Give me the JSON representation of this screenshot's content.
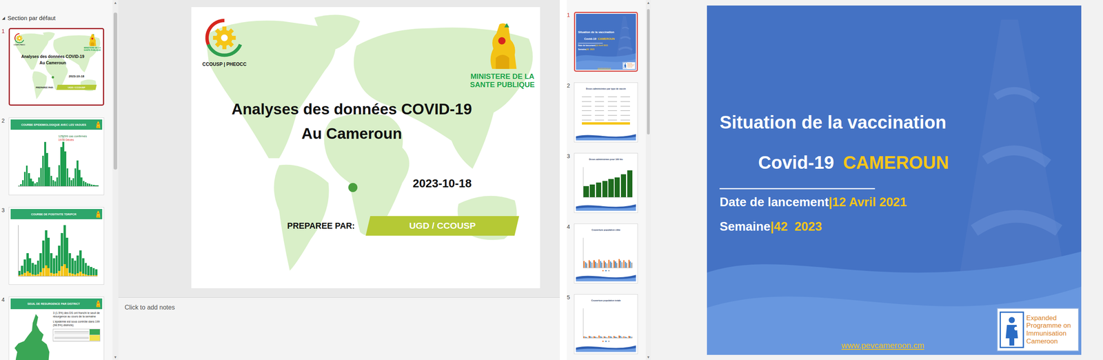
{
  "left_window": {
    "section": {
      "icon": "◢",
      "label": "Section par défaut",
      "expanded": true
    },
    "scrollbar": {
      "up": "▲",
      "down": "▼",
      "thumb_start": 0.02,
      "thumb_size": 0.45
    },
    "thumbnails": [
      {
        "number": "1",
        "kind": "title",
        "selected": true
      },
      {
        "number": "2",
        "kind": "curve",
        "selected": false,
        "title": "COURBE EPIDEMIOLOGIQUE AVEC LES VAGUES",
        "color": "#1e9e50",
        "labels": [
          {
            "text": "125299 cas confirmés",
            "color": "#1f7a3a"
          },
          {
            "text": "1974 Décès",
            "color": "#e0241b"
          }
        ],
        "values": [
          20,
          60,
          180,
          420,
          610,
          380,
          220,
          140,
          90,
          120,
          260,
          540,
          900,
          1300,
          980,
          560,
          300,
          180,
          140,
          260,
          620,
          1150,
          1480,
          1020,
          520,
          260,
          180,
          240,
          520,
          760,
          480,
          260,
          160,
          120,
          90,
          70,
          50,
          40,
          30,
          25
        ]
      },
      {
        "number": "3",
        "kind": "positivity",
        "selected": false,
        "title": "COURBE DE POSITIVITE TDR/PCR",
        "series": [
          {
            "color": "#1e9e50",
            "values": [
              200,
              400,
              650,
              900,
              700,
              500,
              450,
              600,
              900,
              1400,
              1800,
              1500,
              900,
              700,
              800,
              1200,
              1700,
              2000,
              1500,
              900,
              700,
              600,
              800,
              1000,
              700,
              500,
              400,
              350,
              300,
              250
            ]
          },
          {
            "color": "#f2c316",
            "values": [
              20,
              60,
              120,
              180,
              110,
              60,
              40,
              70,
              150,
              300,
              420,
              300,
              120,
              80,
              100,
              200,
              380,
              460,
              300,
              120,
              80,
              60,
              100,
              160,
              90,
              50,
              30,
              25,
              20,
              15
            ]
          }
        ]
      },
      {
        "number": "4",
        "kind": "map",
        "selected": false,
        "title": "SEUIL DE RESURGENCE PAR DISTRICT",
        "lines": [
          "3 (1.5%) des DS ont franchi le seuil de résurgence au cours de la semaine",
          "L'épidémie est sous contrôle dans 199 (98.5%) districts)"
        ],
        "status_colors": [
          "#3aa655",
          "#f2e14c"
        ]
      }
    ],
    "slide": {
      "logo_label": "CCOUSP | PHEOCC",
      "ministry": "MINISTERE DE LA SANTE PUBLIQUE",
      "title_lines": [
        "Analyses des données COVID-19",
        "Au Cameroun"
      ],
      "date": "2023-10-18",
      "prepared_label": "PREPAREE PAR:",
      "prepared_by": "UGD / CCOUSP"
    },
    "notes_placeholder": "Click to add notes"
  },
  "right_window": {
    "scrollbar": {
      "up": "▲",
      "down": "▼",
      "thumb_start": 0.01,
      "thumb_size": 0.36
    },
    "thumbnails": [
      {
        "number": "1",
        "kind": "title",
        "selected": true
      },
      {
        "number": "2",
        "kind": "table",
        "selected": false,
        "title": "Doses administrées par type de vaccin",
        "table_rows": 6
      },
      {
        "number": "3",
        "kind": "bars",
        "selected": false,
        "title": "Doses administrées pour 100 hts",
        "axis_max": 50,
        "series": [
          {
            "color": "#1e6b1e",
            "values": [
              18,
              21,
              24,
              27,
              30,
              33,
              38,
              45
            ]
          }
        ]
      },
      {
        "number": "4",
        "kind": "grouped",
        "selected": false,
        "title": "Couverture population cible",
        "axis_max": 100,
        "series": [
          {
            "color": "#ed7d31",
            "values": [
              22,
              25,
              24,
              27,
              23,
              26,
              25,
              28,
              24,
              26
            ]
          },
          {
            "color": "#5b9bd5",
            "values": [
              18,
              20,
              19,
              22,
              18,
              21,
              20,
              23,
              19,
              21
            ]
          },
          {
            "color": "#a5a5a5",
            "values": [
              14,
              16,
              15,
              17,
              14,
              16,
              15,
              18,
              15,
              16
            ]
          }
        ]
      },
      {
        "number": "5",
        "kind": "grouped",
        "selected": false,
        "title": "Couverture population totale",
        "axis_max": 100,
        "series": [
          {
            "color": "#ed7d31",
            "values": [
              6,
              7,
              6,
              8,
              6,
              7,
              7,
              8,
              6,
              7
            ]
          },
          {
            "color": "#5b9bd5",
            "values": [
              5,
              6,
              5,
              6,
              5,
              6,
              5,
              7,
              5,
              6
            ]
          },
          {
            "color": "#a5a5a5",
            "values": [
              3,
              4,
              3,
              4,
              3,
              4,
              3,
              4,
              3,
              4
            ]
          }
        ]
      }
    ],
    "slide": {
      "title_line1": "Situation de la vaccination",
      "title_line2": [
        {
          "text": "Covid-19",
          "color": "#ffffff"
        },
        {
          "text": "CAMEROUN",
          "color": "#f6c61a"
        }
      ],
      "launch_label": "Date de lancement",
      "separator": "|",
      "launch_date": "12 Avril 2021",
      "week_label": "Semaine",
      "week": "42  2023",
      "logo_lines": [
        "Expanded",
        "Programme on",
        "Immunisation",
        "Cameroon"
      ],
      "website": "www.pevcameroon.cm"
    }
  }
}
